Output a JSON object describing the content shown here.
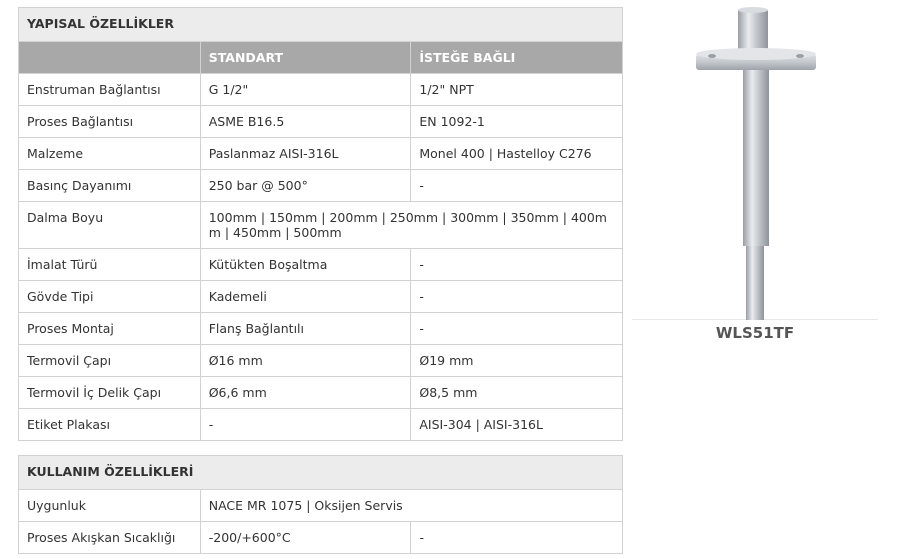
{
  "structural": {
    "title": "YAPISAL ÖZELLİKLER",
    "headers": [
      "STANDART",
      "İSTEĞE BAĞLI"
    ],
    "rows": [
      {
        "label": "Enstruman Bağlantısı",
        "standard": "G 1/2\"",
        "optional": "1/2\" NPT"
      },
      {
        "label": "Proses Bağlantısı",
        "standard": "ASME B16.5",
        "optional": "EN 1092-1"
      },
      {
        "label": "Malzeme",
        "standard": "Paslanmaz AISI-316L",
        "optional": "Monel 400  |  Hastelloy C276"
      },
      {
        "label": "Basınç Dayanımı",
        "standard": "250 bar @ 500°",
        "optional": "-"
      },
      {
        "label": "Dalma Boyu",
        "merged": "100mm | 150mm | 200mm | 250mm | 300mm | 350mm | 400mm | 450mm | 500mm"
      },
      {
        "label": "İmalat Türü",
        "standard": "Kütükten Boşaltma",
        "optional": "-"
      },
      {
        "label": "Gövde Tipi",
        "standard": "Kademeli",
        "optional": "-"
      },
      {
        "label": "Proses Montaj",
        "standard": "Flanş Bağlantılı",
        "optional": "-"
      },
      {
        "label": "Termovil Çapı",
        "standard": "Ø16 mm",
        "optional": "Ø19 mm"
      },
      {
        "label": "Termovil İç Delik Çapı",
        "standard": "Ø6,6 mm",
        "optional": "Ø8,5 mm"
      },
      {
        "label": "Etiket Plakası",
        "standard": "-",
        "optional": "AISI-304  |  AISI-316L"
      }
    ]
  },
  "usage": {
    "title": "KULLANIM ÖZELLİKLERİ",
    "rows": [
      {
        "label": "Uygunluk",
        "merged": "NACE MR 1075  |  Oksijen Servis"
      },
      {
        "label": "Proses Akışkan Sıcaklığı",
        "standard": "-200/+600°C",
        "optional": "-"
      }
    ]
  },
  "product": {
    "caption": "WLS51TF"
  }
}
